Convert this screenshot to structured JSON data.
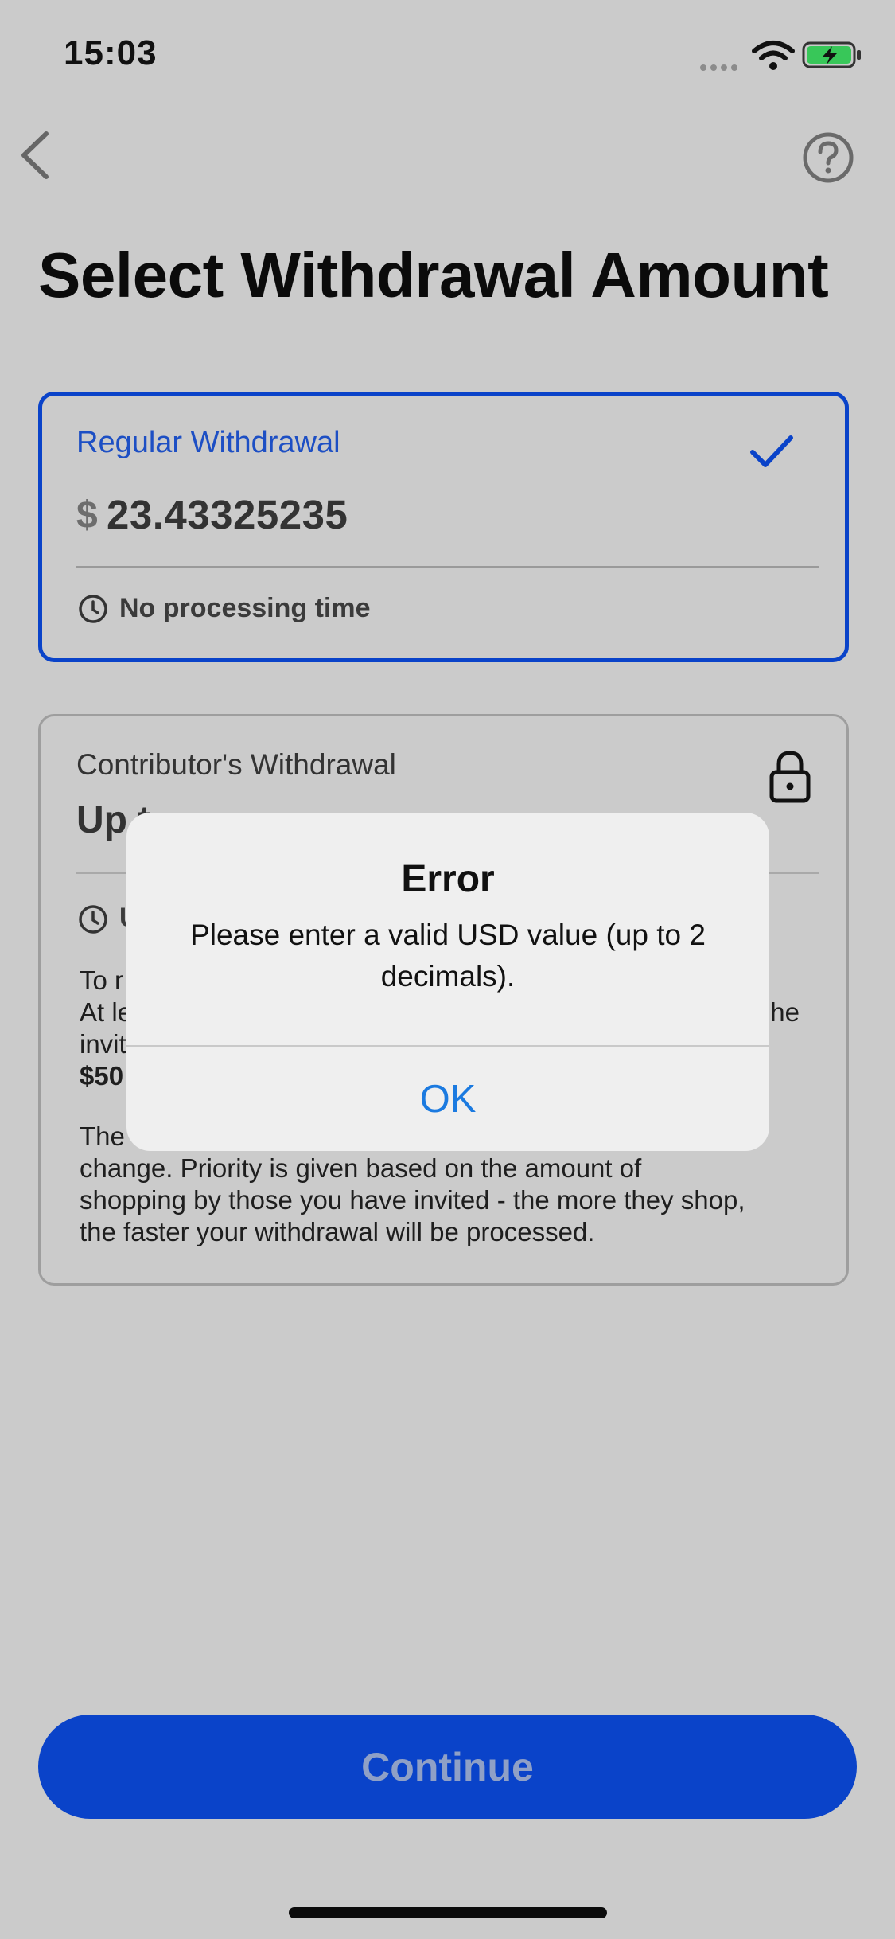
{
  "status_bar": {
    "time": "15:03"
  },
  "page": {
    "title": "Select Withdrawal Amount"
  },
  "regular": {
    "title": "Regular Withdrawal",
    "currency": "$",
    "amount": "23.43325235",
    "processing": "No processing time",
    "selected": true
  },
  "contributor": {
    "title": "Contributor's Withdrawal",
    "amount_visible": "Up t",
    "processing_visible": "U",
    "desc_line1": "To r",
    "desc_line2_start": "At le",
    "desc_line2_end": "he",
    "desc_line3": "invit",
    "desc_line4": "$50",
    "desc_para2_line1_start": "The",
    "desc_para2_line2": "change. Priority is given based on the amount of",
    "desc_para2_line3": "shopping by those you have invited - the more they shop,",
    "desc_para2_line4": "the faster your withdrawal will be processed."
  },
  "alert": {
    "title": "Error",
    "message": "Please enter a valid USD value (up to 2 decimals).",
    "ok_label": "OK"
  },
  "footer": {
    "continue_label": "Continue"
  },
  "colors": {
    "accent": "#0a43c9",
    "alert_button": "#1b7ae0",
    "backdrop": "#cbcbcb"
  }
}
